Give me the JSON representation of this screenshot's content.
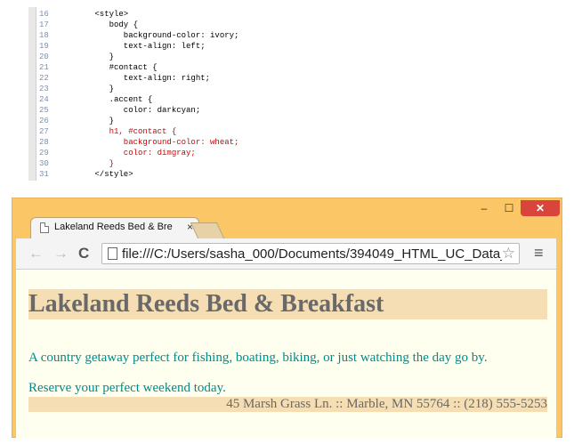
{
  "code": {
    "lines": [
      {
        "num": "16",
        "text": "      <style>",
        "red": false
      },
      {
        "num": "17",
        "text": "         body {",
        "red": false
      },
      {
        "num": "18",
        "text": "            background-color: ivory;",
        "red": false
      },
      {
        "num": "19",
        "text": "            text-align: left;",
        "red": false
      },
      {
        "num": "20",
        "text": "         }",
        "red": false
      },
      {
        "num": "21",
        "text": "         #contact {",
        "red": false
      },
      {
        "num": "22",
        "text": "            text-align: right;",
        "red": false
      },
      {
        "num": "23",
        "text": "         }",
        "red": false
      },
      {
        "num": "24",
        "text": "         .accent {",
        "red": false
      },
      {
        "num": "25",
        "text": "            color: darkcyan;",
        "red": false
      },
      {
        "num": "26",
        "text": "         }",
        "red": false
      },
      {
        "num": "27",
        "text": "         h1, #contact {",
        "red": true
      },
      {
        "num": "28",
        "text": "            background-color: wheat;",
        "red": true
      },
      {
        "num": "29",
        "text": "            color: dimgray;",
        "red": true
      },
      {
        "num": "30",
        "text": "         }",
        "red": true
      },
      {
        "num": "31",
        "text": "      </style>",
        "red": false
      }
    ]
  },
  "browser": {
    "tab_title": "Lakeland Reeds Bed & Bre",
    "tab_close": "×",
    "url": "file:///C:/Users/sasha_000/Documents/394049_HTML_UC_Data_",
    "controls": {
      "minimize": "–",
      "maximize": "☐",
      "close": "✕"
    },
    "nav": {
      "back": "←",
      "forward": "→",
      "reload": "C"
    },
    "star": "☆",
    "menu": "≡"
  },
  "page": {
    "heading": "Lakeland Reeds Bed & Breakfast",
    "tagline": "A country getaway perfect for fishing, boating, biking, or just watching the day go by.",
    "reserve": "Reserve your perfect weekend today.",
    "contact": "45 Marsh Grass Ln. :: Marble, MN 55764 :: (218) 555-5253"
  },
  "colors": {
    "frame": "#fbc766",
    "ivory": "#fffff0",
    "wheat": "#f5deb3",
    "dimgray": "#696969",
    "darkcyan": "#008b8b",
    "close_button": "#d9453a",
    "code_highlight": "#d40000"
  }
}
